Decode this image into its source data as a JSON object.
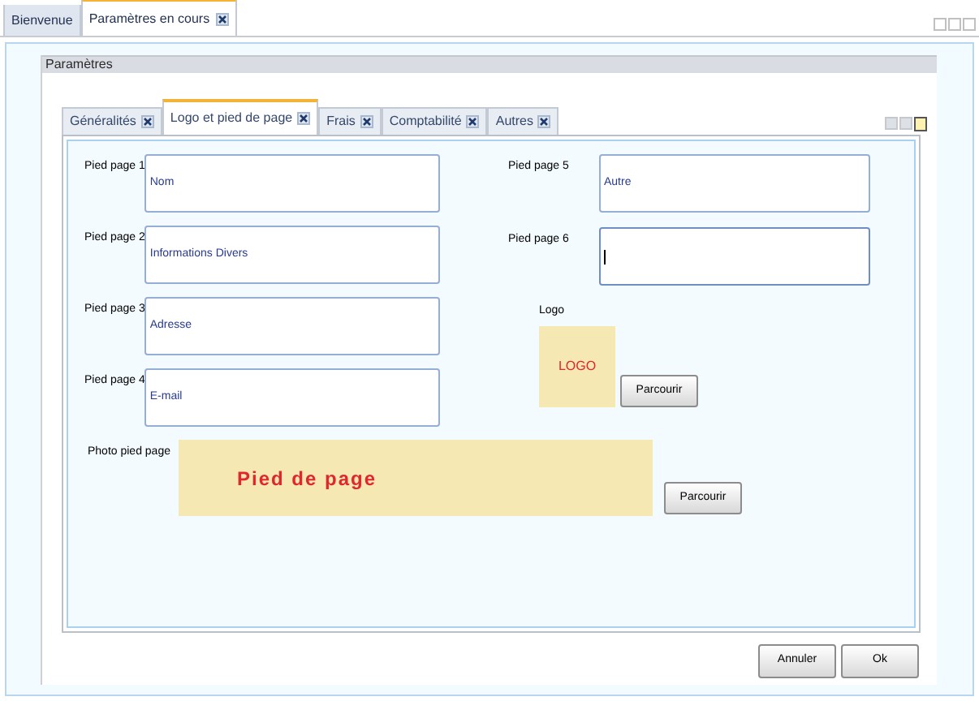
{
  "document_tabs": [
    {
      "label": "Bienvenue",
      "selected": false,
      "closable": false
    },
    {
      "label": "Paramètres en cours",
      "selected": true,
      "closable": true
    }
  ],
  "section_title": "Paramètres",
  "tabs": [
    {
      "label": "Généralités",
      "selected": false
    },
    {
      "label": "Logo et pied de page",
      "selected": true
    },
    {
      "label": "Frais",
      "selected": false
    },
    {
      "label": "Comptabilité",
      "selected": false
    },
    {
      "label": "Autres",
      "selected": false
    }
  ],
  "fields": [
    {
      "label": "Pied page 1",
      "value": "Nom",
      "focused": false
    },
    {
      "label": "Pied page 2",
      "value": "Informations Divers",
      "focused": false
    },
    {
      "label": "Pied page 3",
      "value": "Adresse",
      "focused": false
    },
    {
      "label": "Pied page 4",
      "value": "E-mail",
      "focused": false
    },
    {
      "label": "Pied page 5",
      "value": "Autre",
      "focused": false
    },
    {
      "label": "Pied page 6",
      "focused": true
    }
  ],
  "logo": {
    "label": "Logo",
    "text": "LOGO",
    "button": "Parcourir"
  },
  "photo": {
    "label": "Photo pied page",
    "text": "Pied de page",
    "button": "Parcourir"
  },
  "buttons": [
    "Annuler",
    "Ok"
  ]
}
